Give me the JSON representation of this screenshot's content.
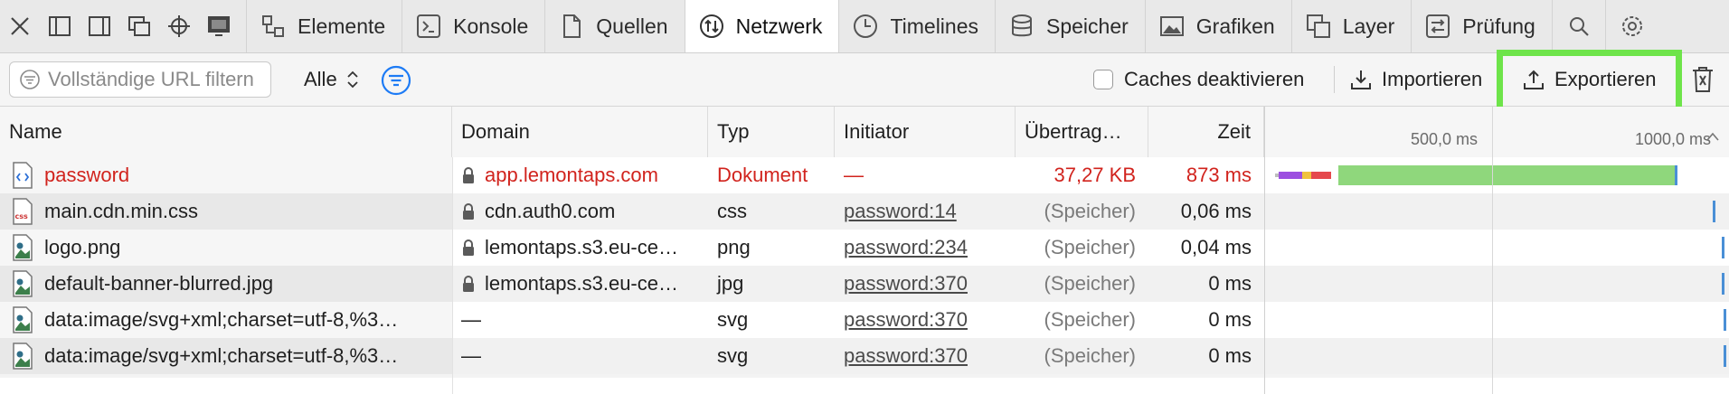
{
  "toolbar": {
    "tools": [
      {
        "icon": "close-icon"
      },
      {
        "icon": "dock-left-icon"
      },
      {
        "icon": "dock-right-icon"
      },
      {
        "icon": "undock-window-icon"
      },
      {
        "icon": "element-picker-icon"
      },
      {
        "icon": "device-preview-icon"
      }
    ],
    "tabs": [
      {
        "label": "Elemente",
        "icon": "elements-icon"
      },
      {
        "label": "Konsole",
        "icon": "console-icon"
      },
      {
        "label": "Quellen",
        "icon": "sources-icon"
      },
      {
        "label": "Netzwerk",
        "icon": "network-icon",
        "active": true
      },
      {
        "label": "Timelines",
        "icon": "timelines-icon"
      },
      {
        "label": "Speicher",
        "icon": "storage-icon"
      },
      {
        "label": "Grafiken",
        "icon": "graphics-icon"
      },
      {
        "label": "Layer",
        "icon": "layers-icon"
      },
      {
        "label": "Prüfung",
        "icon": "audit-icon"
      }
    ],
    "end_icons": [
      "search-icon",
      "settings-icon"
    ]
  },
  "filter": {
    "placeholder": "Vollständige URL filtern",
    "type_value": "Alle",
    "cache_label": "Caches deaktivieren",
    "cache_checked": false,
    "import_label": "Importieren",
    "export_label": "Exportieren",
    "highlight_color": "#6ee44a"
  },
  "table": {
    "headers": {
      "name": "Name",
      "domain": "Domain",
      "type": "Typ",
      "initiator": "Initiator",
      "transferred": "Übertrag…",
      "time": "Zeit"
    },
    "ticks": [
      "500,0 ms",
      "1000,0 ms"
    ],
    "rows": [
      {
        "name": "password",
        "icon": "document-icon",
        "secure": true,
        "domain": "app.lemontaps.com",
        "type": "Dokument",
        "initiator": "—",
        "transferred": "37,27 KB",
        "time": "873 ms",
        "error": true
      },
      {
        "name": "main.cdn.min.css",
        "icon": "css-file-icon",
        "secure": true,
        "domain": "cdn.auth0.com",
        "type": "css",
        "initiator": "password:14",
        "transferred": "(Speicher)",
        "time": "0,06 ms"
      },
      {
        "name": "logo.png",
        "icon": "image-file-icon",
        "secure": true,
        "domain": "lemontaps.s3.eu-ce…",
        "type": "png",
        "initiator": "password:234",
        "transferred": "(Speicher)",
        "time": "0,04 ms"
      },
      {
        "name": "default-banner-blurred.jpg",
        "icon": "image-file-icon",
        "secure": true,
        "domain": "lemontaps.s3.eu-ce…",
        "type": "jpg",
        "initiator": "password:370",
        "transferred": "(Speicher)",
        "time": "0 ms"
      },
      {
        "name": "data:image/svg+xml;charset=utf-8,%3…",
        "icon": "image-file-icon",
        "secure": false,
        "domain": "—",
        "type": "svg",
        "initiator": "password:370",
        "transferred": "(Speicher)",
        "time": "0 ms"
      },
      {
        "name": "data:image/svg+xml;charset=utf-8,%3…",
        "icon": "image-file-icon",
        "secure": false,
        "domain": "—",
        "type": "svg",
        "initiator": "password:370",
        "transferred": "(Speicher)",
        "time": "0 ms"
      }
    ]
  },
  "colors": {
    "error_red": "#d1231d",
    "bar_green": "#8fd77c",
    "bar_purple": "#9c4fe0",
    "bar_yellow": "#f0c23e",
    "bar_red": "#e5484d",
    "bar_blue": "#4a8fd6",
    "accent_blue": "#1d7bf5"
  }
}
